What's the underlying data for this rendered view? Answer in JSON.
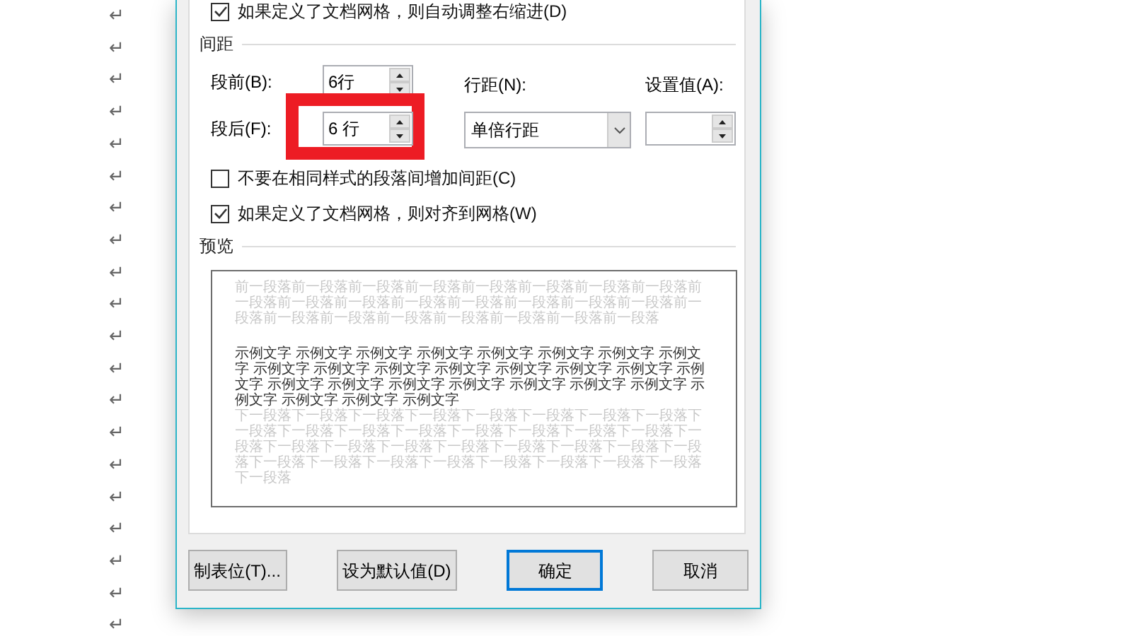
{
  "paragraph_marks": [
    "↵",
    "↵",
    "↵",
    "↵",
    "↵",
    "↵",
    "↵",
    "↵",
    "↵",
    "↵",
    "↵",
    "↵",
    "↵",
    "↵",
    "↵",
    "↵",
    "↵",
    "↵",
    "↵",
    "↵"
  ],
  "dialog": {
    "top_checkbox": {
      "label": "如果定义了文档网格，则自动调整右缩进(D)",
      "checked": true
    },
    "spacing": {
      "title": "间距",
      "before": {
        "label": "段前(B):",
        "value": "6行"
      },
      "after": {
        "label": "段后(F):",
        "value": "6 行",
        "highlight": true
      },
      "line_spacing": {
        "label": "行距(N):",
        "value": "单倍行距"
      },
      "at": {
        "label": "设置值(A):"
      },
      "checkboxes": [
        {
          "label": "不要在相同样式的段落间增加间距(C)",
          "checked": false
        },
        {
          "label": "如果定义了文档网格，则对齐到网格(W)",
          "checked": true
        }
      ]
    },
    "preview": {
      "title": "预览",
      "previous": "前一段落前一段落前一段落前一段落前一段落前一段落前一段落前一段落前一段落前一段落前一段落前一段落前一段落前一段落前一段落前一段落前一段落前一段落前一段落前一段落前一段落前一段落前一段落前一段落",
      "sample": "示例文字 示例文字 示例文字 示例文字 示例文字 示例文字 示例文字 示例文字 示例文字 示例文字 示例文字 示例文字 示例文字 示例文字 示例文字 示例文字 示例文字 示例文字 示例文字 示例文字 示例文字 示例文字 示例文字 示例文字 示例文字 示例文字 示例文字",
      "next": "下一段落下一段落下一段落下一段落下一段落下一段落下一段落下一段落下一段落下一段落下一段落下一段落下一段落下一段落下一段落下一段落下一段落下一段落下一段落下一段落下一段落下一段落下一段落下一段落下一段落下一段落下一段落下一段落下一段落下一段落下一段落下一段落下一段落下一段落"
    },
    "buttons": [
      {
        "label": "制表位(T)...",
        "default": false
      },
      {
        "label": "设为默认值(D)",
        "default": false
      },
      {
        "label": "确定",
        "default": true
      },
      {
        "label": "取消",
        "default": false
      }
    ]
  }
}
